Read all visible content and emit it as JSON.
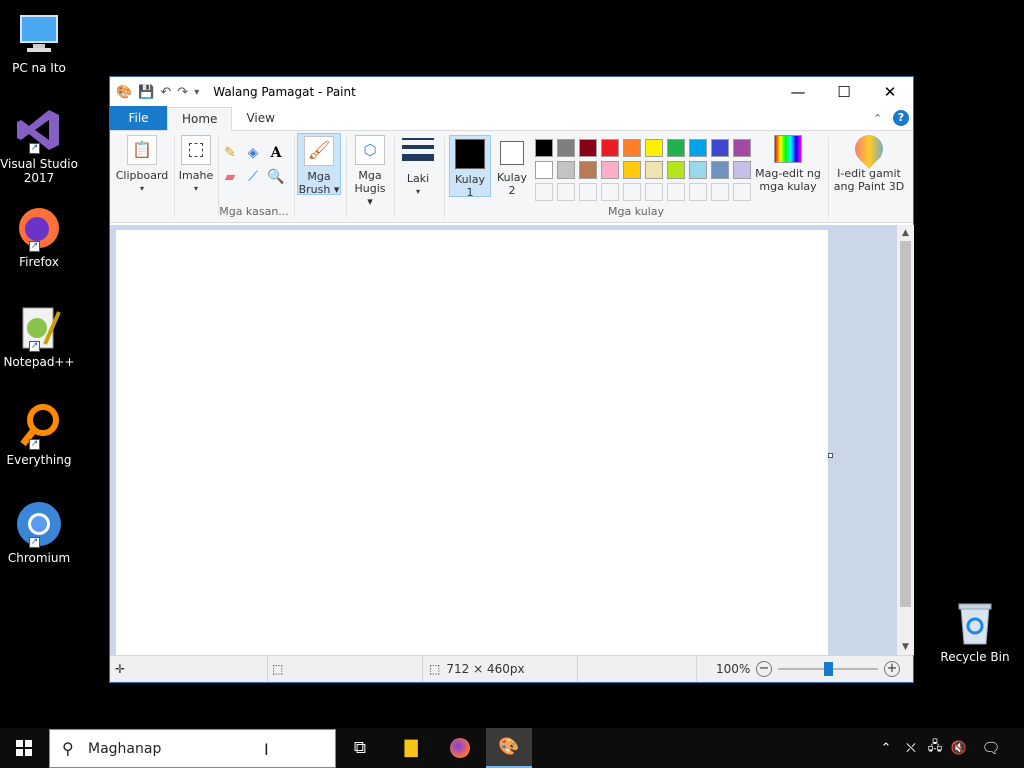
{
  "desktop": {
    "icons": [
      {
        "label": "PC na Ito",
        "icon": "computer-icon"
      },
      {
        "label": "Visual Studio 2017",
        "icon": "visual-studio-icon"
      },
      {
        "label": "Firefox",
        "icon": "firefox-icon"
      },
      {
        "label": "Notepad++",
        "icon": "notepad-plus-plus-icon"
      },
      {
        "label": "Everything",
        "icon": "everything-search-icon"
      },
      {
        "label": "Chromium",
        "icon": "chromium-icon"
      }
    ],
    "recycle_bin": "Recycle Bin"
  },
  "window": {
    "title": "Walang Pamagat - Paint",
    "controls": {
      "minimize": "—",
      "maximize": "☐",
      "close": "✕"
    }
  },
  "tabs": {
    "file": "File",
    "home": "Home",
    "view": "View"
  },
  "ribbon": {
    "clipboard": "Clipboard",
    "image": "Imahe",
    "tools_group": "Mga kasan...",
    "brushes": "Mga Brush",
    "shapes": "Mga Hugis",
    "size": "Laki",
    "color1": "Kulay 1",
    "color2": "Kulay 2",
    "colors_group": "Mga kulay",
    "edit_colors": "Mag-edit ng mga kulay",
    "paint3d": "I-edit gamit ang Paint 3D"
  },
  "palette": {
    "row1": [
      "#000000",
      "#7f7f7f",
      "#880015",
      "#ed1c24",
      "#ff7f27",
      "#fff200",
      "#22b14c",
      "#00a2e8",
      "#3f48cc",
      "#a349a4"
    ],
    "row2": [
      "#ffffff",
      "#c3c3c3",
      "#b97a57",
      "#ffaec9",
      "#ffc90e",
      "#efe4b0",
      "#b5e61d",
      "#99d9ea",
      "#7092be",
      "#c8bfe7"
    ],
    "color1": "#000000",
    "color2": "#ffffff"
  },
  "status": {
    "canvas_size": "712 × 460px",
    "zoom": "100%",
    "zoom_level": 0.5
  },
  "taskbar": {
    "search_placeholder": "Maghanap"
  }
}
